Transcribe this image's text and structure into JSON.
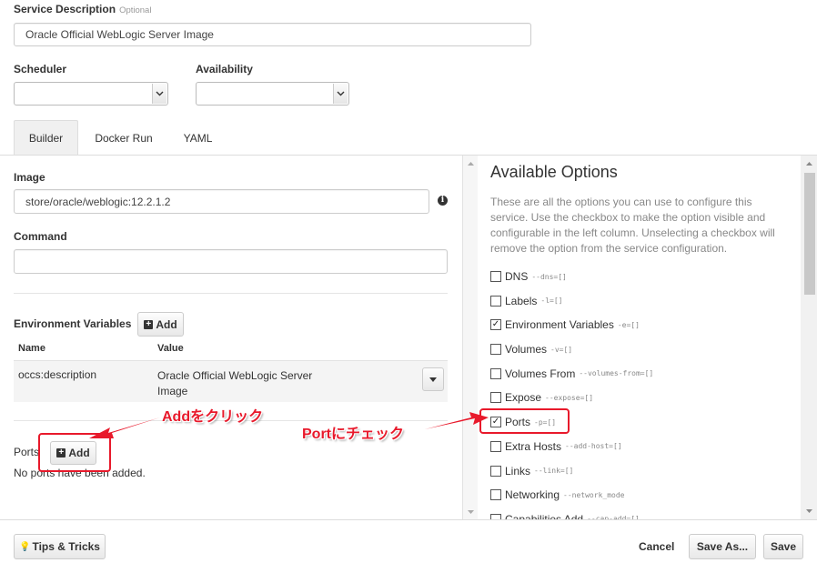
{
  "service_description": {
    "label": "Service Description",
    "optional": "Optional",
    "value": "Oracle Official WebLogic Server Image"
  },
  "scheduler": {
    "label": "Scheduler",
    "value": ""
  },
  "availability": {
    "label": "Availability",
    "value": ""
  },
  "tabs": [
    {
      "label": "Builder",
      "active": true
    },
    {
      "label": "Docker Run",
      "active": false
    },
    {
      "label": "YAML",
      "active": false
    }
  ],
  "image": {
    "label": "Image",
    "value": "store/oracle/weblogic:12.2.1.2"
  },
  "command": {
    "label": "Command",
    "value": ""
  },
  "env": {
    "label": "Environment Variables",
    "add_label": "Add",
    "col_name": "Name",
    "col_value": "Value",
    "rows": [
      {
        "name": "occs:description",
        "value_line1": "Oracle Official WebLogic Server",
        "value_line2": "Image"
      }
    ]
  },
  "ports": {
    "label": "Ports",
    "add_label": "Add",
    "empty": "No ports have been added."
  },
  "annotations": {
    "add_click": "Addをクリック",
    "port_check": "Portにチェック",
    "color": "#e8192b"
  },
  "options": {
    "title": "Available Options",
    "description": "These are all the options you can use to configure this service. Use the checkbox to make the option visible and configurable in the left column. Unselecting a checkbox will remove the option from the service configuration.",
    "items": [
      {
        "label": "DNS",
        "flag": "--dns=[]",
        "checked": false
      },
      {
        "label": "Labels",
        "flag": "-l=[]",
        "checked": false
      },
      {
        "label": "Environment Variables",
        "flag": "-e=[]",
        "checked": true
      },
      {
        "label": "Volumes",
        "flag": "-v=[]",
        "checked": false
      },
      {
        "label": "Volumes From",
        "flag": "--volumes-from=[]",
        "checked": false
      },
      {
        "label": "Expose",
        "flag": "--expose=[]",
        "checked": false
      },
      {
        "label": "Ports",
        "flag": "-p=[]",
        "checked": true
      },
      {
        "label": "Extra Hosts",
        "flag": "--add-host=[]",
        "checked": false
      },
      {
        "label": "Links",
        "flag": "--link=[]",
        "checked": false
      },
      {
        "label": "Networking",
        "flag": "--network_mode",
        "checked": false
      },
      {
        "label": "Capabilities Add",
        "flag": "--cap-add=[]",
        "checked": false
      }
    ]
  },
  "footer": {
    "tips": "Tips & Tricks",
    "cancel": "Cancel",
    "save_as": "Save As...",
    "save": "Save"
  }
}
